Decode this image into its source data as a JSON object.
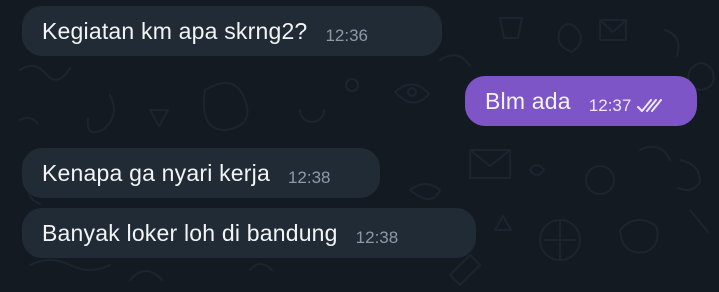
{
  "colors": {
    "background": "#131a22",
    "incoming_bubble": "#212b35",
    "outgoing_bubble": "#7d55c7",
    "text": "#f2f4f6",
    "incoming_time": "#8d99a6",
    "outgoing_time": "#efe7fb"
  },
  "messages": [
    {
      "direction": "incoming",
      "text": "Kegiatan km apa skrng2?",
      "time": "12:36"
    },
    {
      "direction": "outgoing",
      "text": "Blm ada",
      "time": "12:37",
      "status_icon": "double-check-icon"
    },
    {
      "direction": "incoming",
      "text": "Kenapa ga nyari kerja",
      "time": "12:38"
    },
    {
      "direction": "incoming",
      "text": "Banyak loker loh di bandung",
      "time": "12:38"
    }
  ]
}
